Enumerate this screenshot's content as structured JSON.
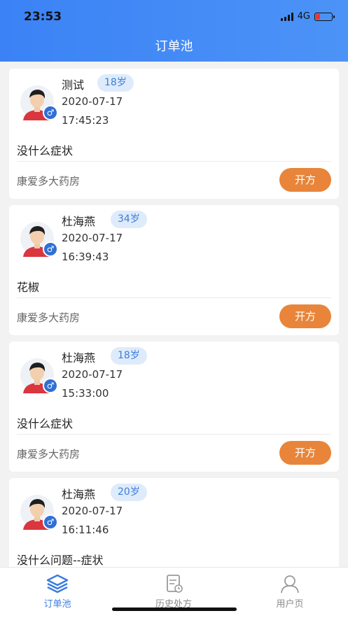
{
  "status_bar": {
    "time": "23:53",
    "network": "4G",
    "signal_icon": "signal-bars-icon",
    "battery_icon": "battery-low-icon"
  },
  "nav": {
    "title": "订单池"
  },
  "orders": [
    {
      "name": "测试",
      "age": "18岁",
      "gender_symbol": "♂",
      "date": "2020-07-17",
      "time": "17:45:23",
      "symptom": "没什么症状",
      "pharmacy": "康爱多大药房",
      "action": "开方"
    },
    {
      "name": "杜海燕",
      "age": "34岁",
      "gender_symbol": "♂",
      "date": "2020-07-17",
      "time": "16:39:43",
      "symptom": "花椒",
      "pharmacy": "康爱多大药房",
      "action": "开方"
    },
    {
      "name": "杜海燕",
      "age": "18岁",
      "gender_symbol": "♂",
      "date": "2020-07-17",
      "time": "15:33:00",
      "symptom": "没什么症状",
      "pharmacy": "康爱多大药房",
      "action": "开方"
    },
    {
      "name": "杜海燕",
      "age": "20岁",
      "gender_symbol": "♂",
      "date": "2020-07-17",
      "time": "16:11:46",
      "symptom": "没什么问题--症状",
      "pharmacy": "",
      "action": ""
    }
  ],
  "tabbar": {
    "tabs": [
      {
        "label": "订单池",
        "icon": "layers-icon",
        "active": true
      },
      {
        "label": "历史处方",
        "icon": "prescription-history-icon",
        "active": false
      },
      {
        "label": "用户页",
        "icon": "user-icon",
        "active": false
      }
    ]
  },
  "colors": {
    "header": "#3b82f6",
    "accent_button": "#e8853a",
    "age_tag_bg": "#deebfb",
    "age_tag_text": "#3d7ddb",
    "active_tab": "#3b7de0"
  }
}
